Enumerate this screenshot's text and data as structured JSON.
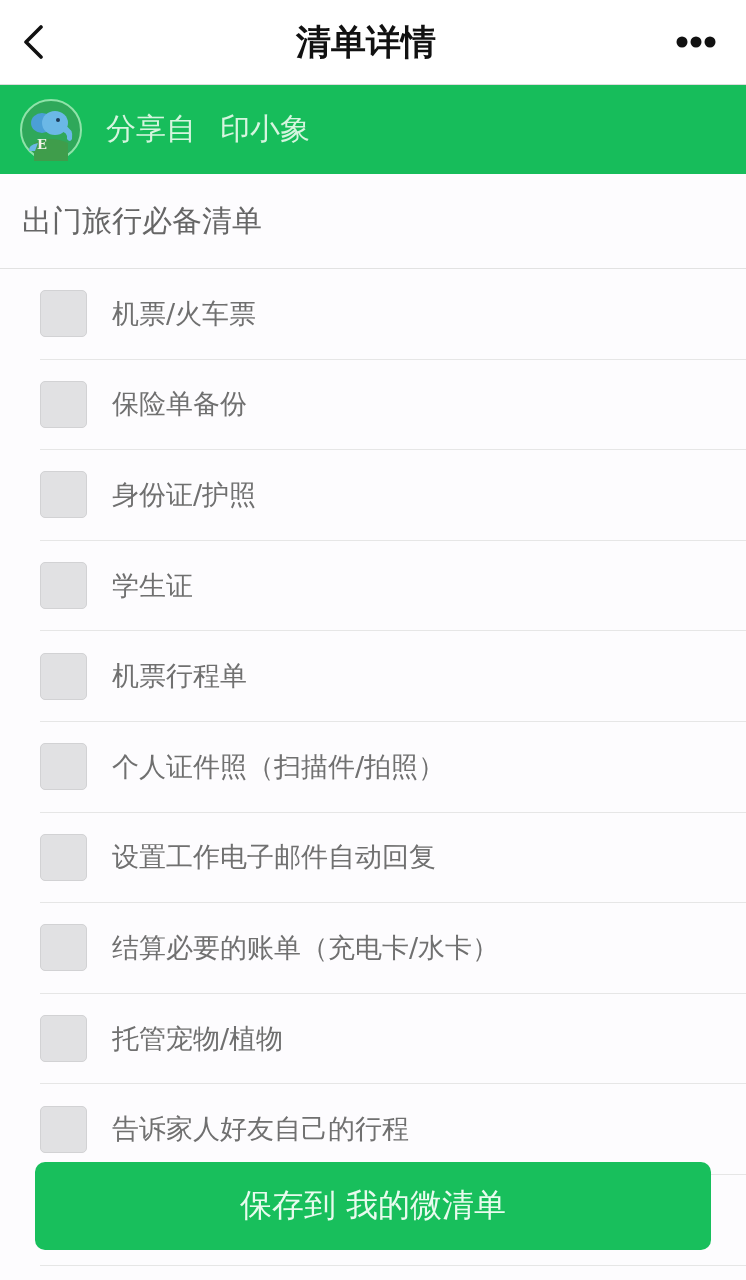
{
  "header": {
    "title": "清单详情"
  },
  "share_banner": {
    "avatar_letter": "E",
    "label": "分享自",
    "source": "印小象"
  },
  "list": {
    "title": "出门旅行必备清单",
    "items": [
      {
        "label": "机票/火车票",
        "checked": false
      },
      {
        "label": "保险单备份",
        "checked": false
      },
      {
        "label": "身份证/护照",
        "checked": false
      },
      {
        "label": "学生证",
        "checked": false
      },
      {
        "label": "机票行程单",
        "checked": false
      },
      {
        "label": "个人证件照（扫描件/拍照）",
        "checked": false
      },
      {
        "label": "设置工作电子邮件自动回复",
        "checked": false
      },
      {
        "label": "结算必要的账单（充电卡/水卡）",
        "checked": false
      },
      {
        "label": "托管宠物/植物",
        "checked": false
      },
      {
        "label": "告诉家人好友自己的行程",
        "checked": false
      }
    ]
  },
  "save_button": {
    "label": "保存到 我的微清单"
  }
}
